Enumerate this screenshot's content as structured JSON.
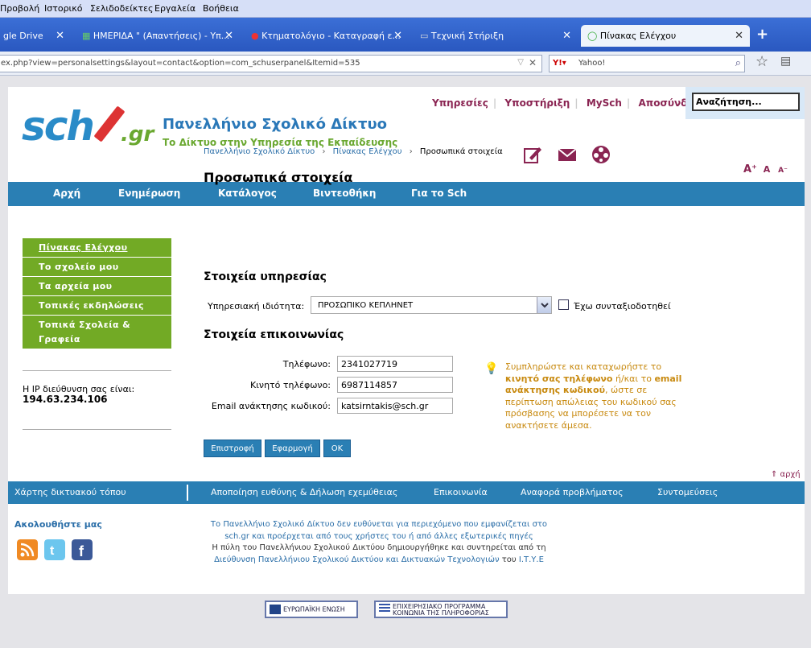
{
  "browser": {
    "menu": [
      "Προβολή",
      "Ιστορικό",
      "Σελιδοδείκτες",
      "Εργαλεία",
      "Βοήθεια"
    ],
    "tabs": [
      {
        "label": "gle Drive"
      },
      {
        "label": "ΗΜΕΡΙΔΑ \" (Απαντήσεις) - Υπ..."
      },
      {
        "label": "Κτηματολόγιο - Καταγραφή ε..."
      },
      {
        "label": "Τεχνική Στήριξη"
      },
      {
        "label": "Πίνακας Ελέγχου"
      }
    ],
    "url": "ex.php?view=personalsettings&layout=contact&option=com_schuserpanel&Itemid=535",
    "search_engine": "Yahoo!"
  },
  "site": {
    "title": "Πανελλήνιο Σχολικό Δίκτυο",
    "subtitle": "Το Δίκτυο στην Υπηρεσία της Εκπαίδευσης",
    "top_links": [
      "Υπηρεσίες",
      "Υποστήριξη",
      "MySch",
      "Αποσύνδεση"
    ],
    "search_placeholder": "Αναζήτηση...",
    "main_nav": [
      "Αρχή",
      "Ενημέρωση",
      "Κατάλογος",
      "Βιντεοθήκη",
      "Για το Sch"
    ]
  },
  "sidebar": {
    "items": [
      "Πίνακας Ελέγχου",
      "Το σχολείο μου",
      "Τα αρχεία μου",
      "Τοπικές εκδηλώσεις",
      "Τοπικά Σχολεία & Γραφεία"
    ],
    "ip_label": "Η IP διεύθυνση σας είναι:",
    "ip_value": "194.63.234.106"
  },
  "breadcrumb": [
    "Πανελλήνιο Σχολικό Δίκτυο",
    "Πίνακας Ελέγχου",
    "Προσωπικά στοιχεία"
  ],
  "form": {
    "heading": "Προσωπικά στοιχεία",
    "service_heading": "Στοιχεία υπηρεσίας",
    "role_label": "Υπηρεσιακή ιδιότητα:",
    "role_value": "ΠΡΟΣΩΠΙΚΟ ΚΕΠΛΗΝΕΤ",
    "retired_label": "Έχω συνταξιοδοτηθεί",
    "contact_heading": "Στοιχεία επικοινωνίας",
    "phone_label": "Τηλέφωνο:",
    "phone_value": "2341027719",
    "mobile_label": "Κινητό τηλέφωνο:",
    "mobile_value": "6987114857",
    "email_label": "Email ανάκτησης κωδικού:",
    "email_value": "katsirntakis@sch.gr",
    "hint": {
      "p1": "Συμπληρώστε και καταχωρήστε το",
      "b1": "κινητό σας τηλέφωνο",
      "p2": "ή/και το",
      "b2": "email ανάκτησης κωδικού",
      "p3": ", ώστε σε περίπτωση απώλειας του κωδικού σας πρόσβασης να μπορέσετε να τον ανακτήσετε άμεσα."
    },
    "buttons": [
      "Επιστροφή",
      "Εφαρμογή",
      "OK"
    ]
  },
  "top_link": "⇑ αρχή",
  "footer": {
    "nav": [
      "Χάρτης δικτυακού τόπου",
      "Αποποίηση ευθύνης & Δήλωση εχεμύθειας",
      "Επικοινωνία",
      "Αναφορά προβλήματος",
      "Συντομεύσεις"
    ],
    "follow": "Ακολουθήστε μας",
    "disclaimer1": "Το Πανελλήνιο Σχολικό Δίκτυο δεν ευθύνεται για περιεχόμενο που εμφανίζεται στο",
    "disclaimer2": "sch.gr και προέρχεται από τους χρήστες του ή από άλλες εξωτερικές πηγές",
    "disclaimer3": "Η πύλη του Πανελλήνιου Σχολικού Δικτύου δημιουργήθηκε και συντηρείται από τη",
    "disclaimer4a": "Διεύθυνση Πανελλήνιου Σχολικού Δικτύου και Δικτυακών Τεχνολογιών",
    "disclaimer4b": "του",
    "disclaimer4c": "Ι.Τ.Υ.Ε",
    "eu_logo": "ΕΥΡΩΠΑΪΚΗ ΕΝΩΣΗ",
    "op_logo1": "ΕΠΙΧΕΙΡΗΣΙΑΚΟ ΠΡΟΓΡΑΜΜΑ",
    "op_logo2": "ΚΟΙΝΩΝΙΑ ΤΗΣ ΠΛΗΡΟΦΟΡΙΑΣ"
  }
}
